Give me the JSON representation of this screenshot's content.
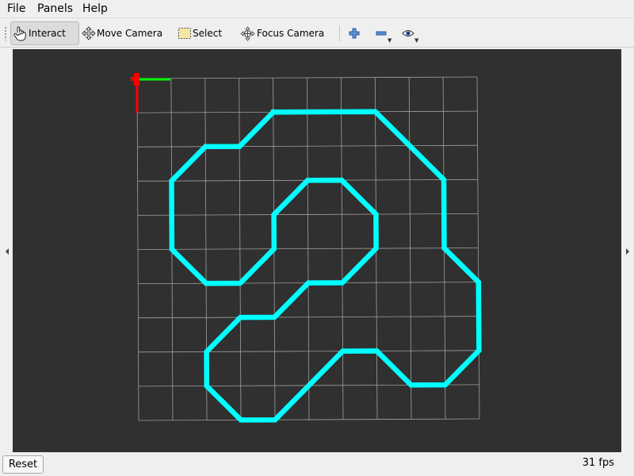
{
  "menubar": {
    "file": "File",
    "panels": "Panels",
    "help": "Help"
  },
  "toolbar": {
    "tools": [
      {
        "label": "Interact",
        "icon": "hand-pointer-icon",
        "active": true
      },
      {
        "label": "Move Camera",
        "icon": "move-camera-icon",
        "active": false
      },
      {
        "label": "Select",
        "icon": "select-box-icon",
        "active": false
      },
      {
        "label": "Focus Camera",
        "icon": "focus-camera-icon",
        "active": false
      }
    ],
    "icon_buttons": [
      "add-tool-icon",
      "remove-tool-icon",
      "view-eye-icon"
    ]
  },
  "viewport": {
    "background": "#303030",
    "grid_color": "#a0a0a0",
    "path_color": "#00ffff",
    "axis_x_color": "#00ff00",
    "axis_y_color": "#ff0000"
  },
  "statusbar": {
    "reset_label": "Reset",
    "fps": "31 fps"
  }
}
